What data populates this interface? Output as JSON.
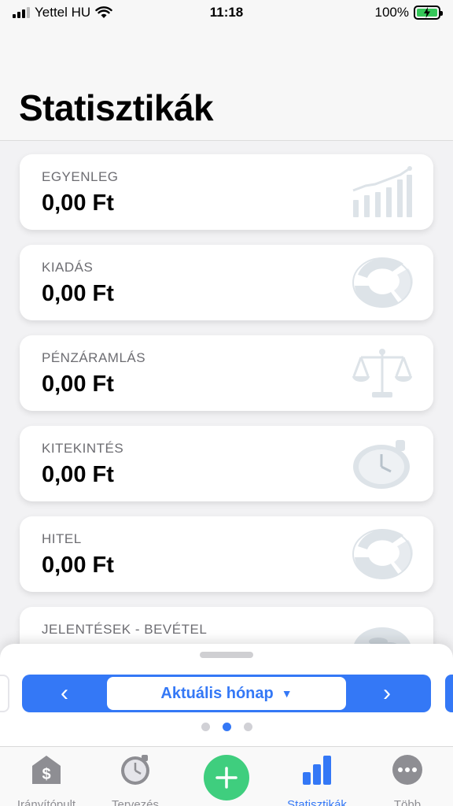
{
  "status_bar": {
    "carrier": "Yettel HU",
    "time": "11:18",
    "battery": "100%"
  },
  "header": {
    "title": "Statisztikák"
  },
  "cards": [
    {
      "label": "EGYENLEG",
      "value": "0,00 Ft",
      "icon": "bar-chart-growth-icon"
    },
    {
      "label": "KIADÁS",
      "value": "0,00 Ft",
      "icon": "donut-chart-icon"
    },
    {
      "label": "PÉNZÁRAMLÁS",
      "value": "0,00 Ft",
      "icon": "balance-scale-icon"
    },
    {
      "label": "KITEKINTÉS",
      "value": "0,00 Ft",
      "icon": "clock-icon"
    },
    {
      "label": "HITEL",
      "value": "0,00 Ft",
      "icon": "donut-chart-icon"
    },
    {
      "label": "JELENTÉSEK - BEVÉTEL",
      "value": "",
      "icon": "coins-icon"
    }
  ],
  "period": {
    "prev": "‹",
    "label": "Aktuális hónap",
    "caret": "▼",
    "next": "›",
    "page_count": 3,
    "active_page": 2
  },
  "tabs": {
    "dashboard": "Irányítópult",
    "planning": "Tervezés",
    "add": "+",
    "statistics": "Statisztikák",
    "more": "Több"
  },
  "colors": {
    "accent": "#3478f6",
    "add": "#3fce7e",
    "icon_gray": "#dde3e8",
    "battery": "#35c759"
  }
}
